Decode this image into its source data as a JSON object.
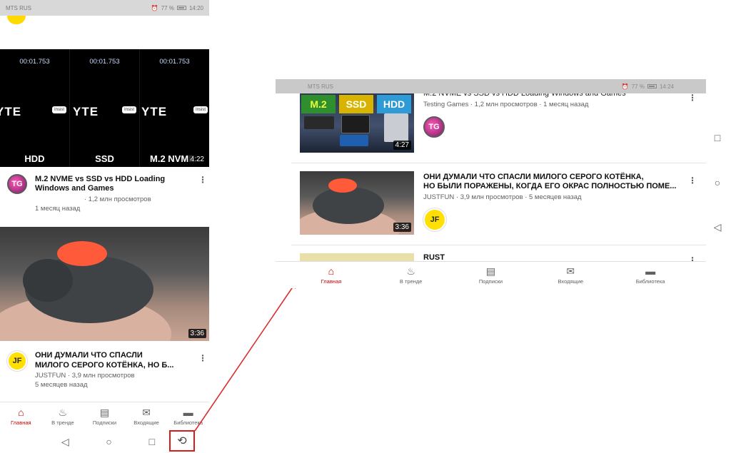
{
  "portrait": {
    "status": {
      "carrier": "MTS RUS",
      "battery": "77 %",
      "time": "14:20"
    },
    "video1": {
      "timestamps": [
        "00:01.753",
        "00:01.753",
        "00:01.753"
      ],
      "brand_text": "YTE",
      "brand_small": "Insist",
      "drive_labels": [
        "HDD",
        "SSD",
        "M.2 NVME"
      ],
      "duration": "4:22",
      "avatar_text": "TG",
      "title_line1": "M.2 NVME vs SSD vs HDD Loading",
      "title_line2": "Windows and Games",
      "views": "· 1,2 млн просмотров",
      "age": "1 месяц назад"
    },
    "video2": {
      "duration": "3:36",
      "avatar_text": "JF",
      "title_line1": "ОНИ ДУМАЛИ ЧТО СПАСЛИ",
      "title_line2": "МИЛОГО СЕРОГО КОТЁНКА, НО Б...",
      "channel_views": "JUSTFUN · 3,9 млн просмотров",
      "age": "5 месяцев назад"
    },
    "nav": [
      {
        "label": "Главная",
        "icon": "home-icon"
      },
      {
        "label": "В тренде",
        "icon": "fire-icon"
      },
      {
        "label": "Подписки",
        "icon": "subscriptions-icon"
      },
      {
        "label": "Входящие",
        "icon": "mail-icon"
      },
      {
        "label": "Библиотека",
        "icon": "folder-icon"
      }
    ]
  },
  "landscape": {
    "status": {
      "carrier": "MTS RUS",
      "battery": "77 %",
      "time": "14:24"
    },
    "video1": {
      "thumb_tags": [
        "M.2",
        "SSD",
        "HDD"
      ],
      "duration": "4:27",
      "avatar_text": "TG",
      "title": "M.2 NVME vs SSD vs HDD Loading Windows and Games",
      "meta": "Testing Games · 1,2 млн просмотров · 1 месяц назад"
    },
    "video2": {
      "duration": "3:36",
      "avatar_text": "JF",
      "title_line1": "ОНИ ДУМАЛИ ЧТО СПАСЛИ МИЛОГО СЕРОГО КОТЁНКА,",
      "title_line2": "НО БЫЛИ ПОРАЖЕНЫ, КОГДА ЕГО ОКРАС ПОЛНОСТЬЮ ПОМЕ...",
      "meta": "JUSTFUN · 3,9 млн просмотров · 5 месяцев назад"
    },
    "video3": {
      "title": "RUST"
    },
    "nav": [
      {
        "label": "Главная",
        "icon": "home-icon"
      },
      {
        "label": "В тренде",
        "icon": "fire-icon"
      },
      {
        "label": "Подписки",
        "icon": "subscriptions-icon"
      },
      {
        "label": "Входящие",
        "icon": "mail-icon"
      },
      {
        "label": "Библиотека",
        "icon": "folder-icon"
      }
    ]
  },
  "colors": {
    "accent": "#cc0000",
    "highlight_box": "#d91b1b",
    "arrow": "#d93030"
  }
}
